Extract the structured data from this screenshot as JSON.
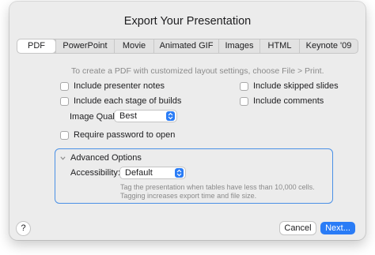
{
  "dialog": {
    "title": "Export Your Presentation"
  },
  "tabs": [
    {
      "label": "PDF",
      "active": true
    },
    {
      "label": "PowerPoint",
      "active": false
    },
    {
      "label": "Movie",
      "active": false
    },
    {
      "label": "Animated GIF",
      "active": false
    },
    {
      "label": "Images",
      "active": false
    },
    {
      "label": "HTML",
      "active": false
    },
    {
      "label": "Keynote '09",
      "active": false
    }
  ],
  "pdf": {
    "hint": "To create a PDF with customized layout settings, choose File > Print.",
    "options": {
      "presenter_notes": {
        "label": "Include presenter notes",
        "checked": false
      },
      "stage_builds": {
        "label": "Include each stage of builds",
        "checked": false
      },
      "skipped_slides": {
        "label": "Include skipped slides",
        "checked": false
      },
      "comments": {
        "label": "Include comments",
        "checked": false
      },
      "require_password": {
        "label": "Require password to open",
        "checked": false
      }
    },
    "image_quality": {
      "label": "Image Quality:",
      "value": "Best"
    },
    "advanced": {
      "label": "Advanced Options",
      "expanded": true,
      "accessibility": {
        "label": "Accessibility:",
        "value": "Default"
      },
      "hint": "Tag the presentation when tables have less than 10,000 cells. Tagging increases export time and file size."
    }
  },
  "footer": {
    "help_label": "?",
    "cancel_label": "Cancel",
    "next_label": "Next..."
  },
  "colors": {
    "accent": "#2a7cf6",
    "dialog_bg": "#ececec",
    "focus_border": "#4a90e6"
  }
}
